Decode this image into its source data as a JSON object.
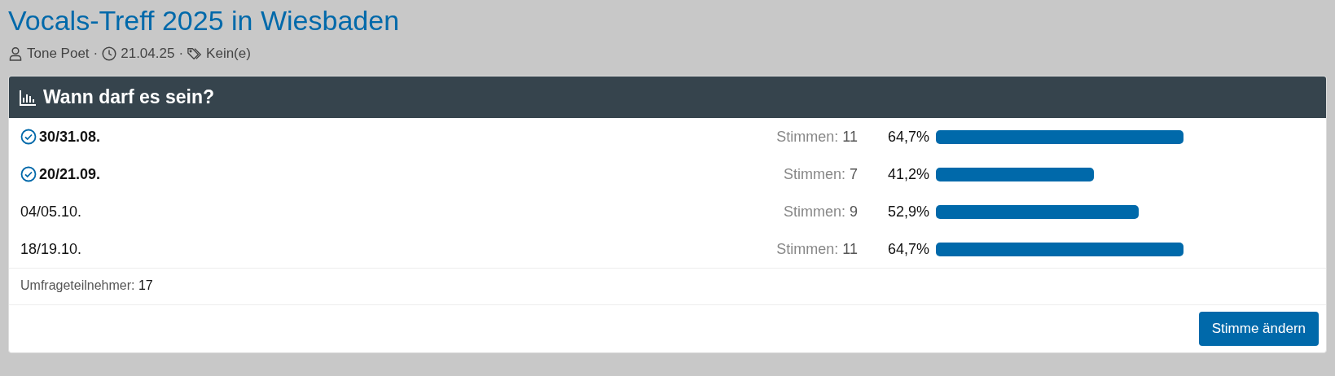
{
  "title": "Vocals-Treff 2025 in Wiesbaden",
  "meta": {
    "author": "Tone Poet",
    "separator": "·",
    "date": "21.04.25",
    "tags": "Kein(e)"
  },
  "poll": {
    "question": "Wann darf es sein?",
    "options": [
      {
        "label": "30/31.08.",
        "voted": true,
        "votes_label": "Stimmen:",
        "votes": "11",
        "percent": "64,7%"
      },
      {
        "label": "20/21.09.",
        "voted": true,
        "votes_label": "Stimmen:",
        "votes": "7",
        "percent": "41,2%"
      },
      {
        "label": "04/05.10.",
        "voted": false,
        "votes_label": "Stimmen:",
        "votes": "9",
        "percent": "52,9%"
      },
      {
        "label": "18/19.10.",
        "voted": false,
        "votes_label": "Stimmen:",
        "votes": "11",
        "percent": "64,7%"
      }
    ],
    "participants_label": "Umfrageteilnehmer:",
    "participants": "17",
    "button": "Stimme ändern"
  }
}
